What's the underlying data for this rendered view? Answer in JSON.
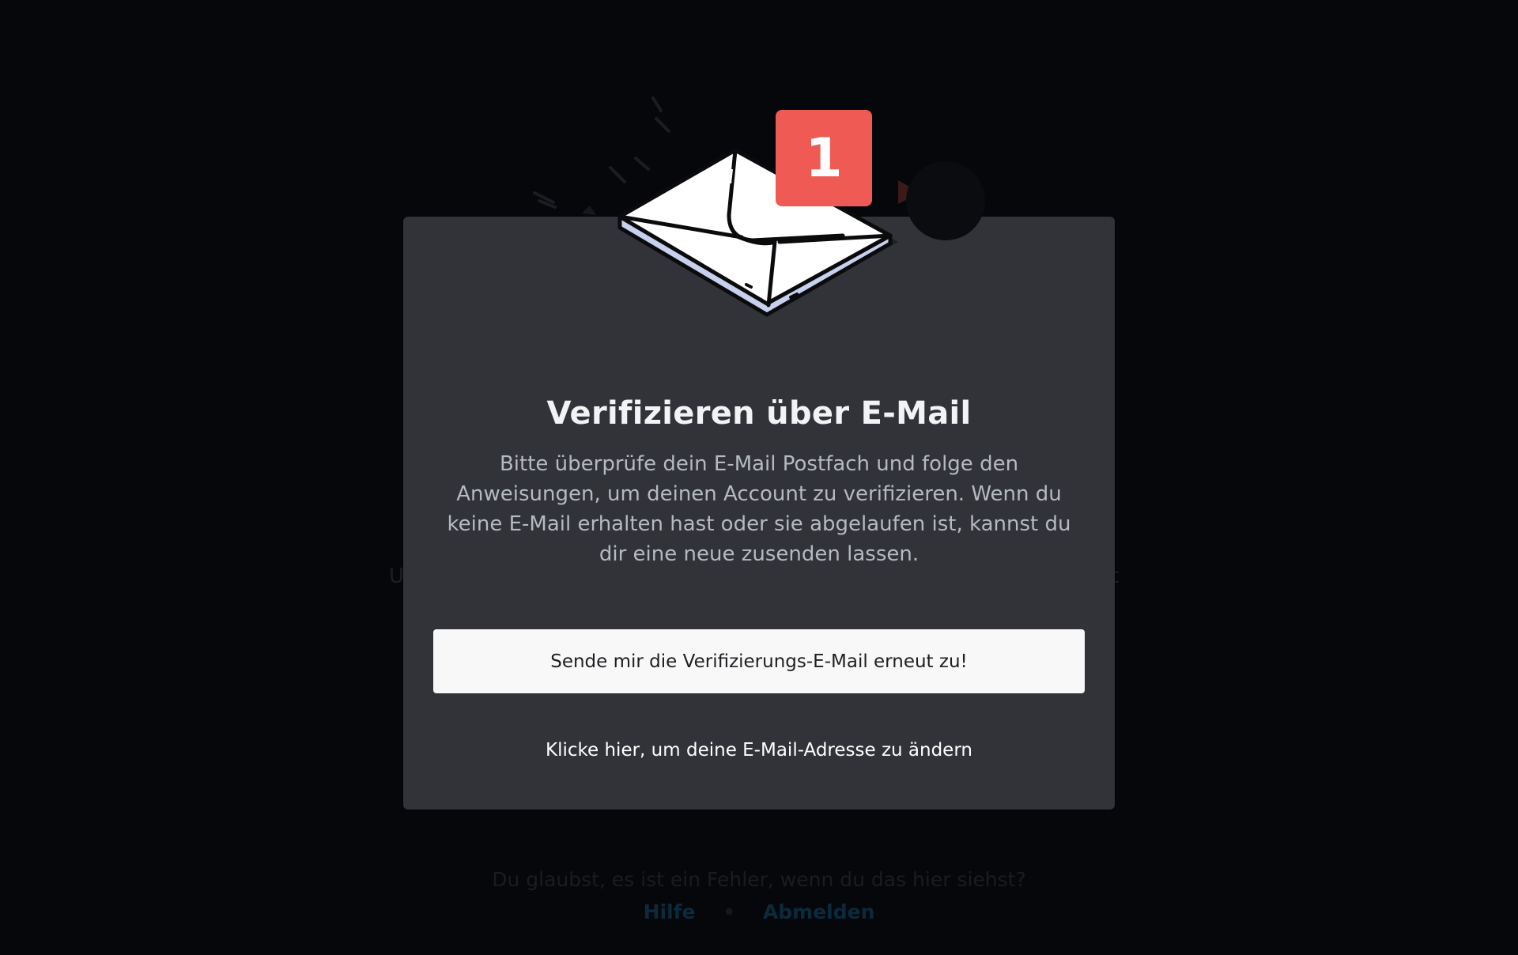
{
  "background": {
    "hint_left": "U",
    "hint_right": "it",
    "footer_question": "Du glaubst, es ist ein Fehler, wenn du das hier siehst?",
    "help_link": "Hilfe",
    "separator": "•",
    "logout_link": "Abmelden"
  },
  "modal": {
    "badge_count": "1",
    "title": "Verifizieren über E-Mail",
    "body": "Bitte überprüfe dein E-Mail Postfach und folge den Anweisungen, um deinen Account zu verifizieren. Wenn du keine E-Mail erhalten hast oder sie abgelaufen ist, kannst du dir eine neue zusenden lassen.",
    "resend_button_label": "Sende mir die Verifizierungs-E-Mail erneut zu!",
    "change_email_label": "Klicke hier, um deine E-Mail-Adresse zu ändern"
  },
  "colors": {
    "backdrop": "#06070a",
    "modal_bg": "#313338",
    "badge": "#f05a55",
    "button_bg": "#f8f8f8"
  },
  "icons": [
    "envelope-icon",
    "notification-badge"
  ]
}
